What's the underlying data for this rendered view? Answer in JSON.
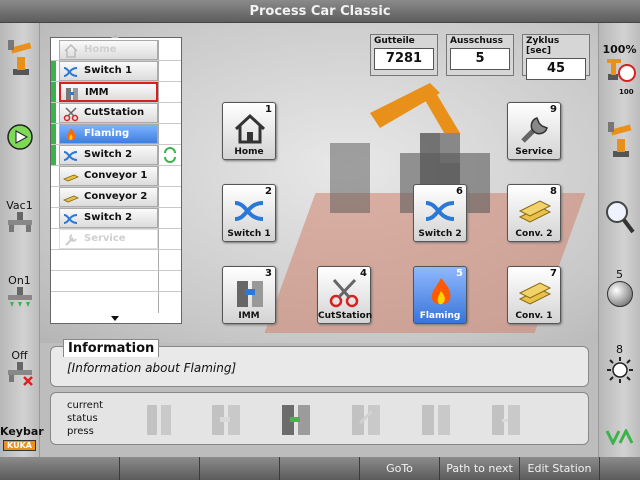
{
  "window": {
    "title": "Process Car Classic"
  },
  "left_panel": {
    "items": [
      {
        "label": ""
      },
      {
        "label": ""
      },
      {
        "label": "Vac1"
      },
      {
        "label": "On1"
      },
      {
        "label": "Off"
      },
      {
        "label": "Keybar",
        "badge": "KUKA"
      }
    ]
  },
  "right_panel": {
    "zoom": "100%",
    "speed_badge": "100",
    "knob_top_label": "5",
    "sun_label": "8"
  },
  "station_list": {
    "rows": [
      {
        "label": "Home",
        "state": "disabled",
        "icon": "home-icon",
        "bar": "#ffffff"
      },
      {
        "label": "Switch 1",
        "state": "normal",
        "icon": "switch-icon",
        "bar": "#3cb34a"
      },
      {
        "label": "IMM",
        "state": "boxed",
        "icon": "imm-icon",
        "bar": "#3cb34a"
      },
      {
        "label": "CutStation",
        "state": "normal",
        "icon": "scissors-icon",
        "bar": "#3cb34a"
      },
      {
        "label": "Flaming",
        "state": "selected",
        "icon": "flame-icon",
        "bar": "#3cb34a"
      },
      {
        "label": "Switch 2",
        "state": "normal",
        "icon": "switch-icon",
        "bar": "#3cb34a",
        "side_icon": "green-arrows-icon"
      },
      {
        "label": "Conveyor 1",
        "state": "normal",
        "icon": "conveyor-icon",
        "bar": "#ffffff"
      },
      {
        "label": "Conveyor 2",
        "state": "normal",
        "icon": "conveyor-icon",
        "bar": "#ffffff"
      },
      {
        "label": "Switch 2",
        "state": "normal",
        "icon": "switch-icon",
        "bar": "#ffffff"
      },
      {
        "label": "Service",
        "state": "disabled",
        "icon": "wrench-icon",
        "bar": "#ffffff"
      },
      {
        "label": "",
        "state": "empty",
        "icon": "",
        "bar": "#ffffff"
      },
      {
        "label": "",
        "state": "empty",
        "icon": "",
        "bar": "#ffffff"
      },
      {
        "label": "",
        "state": "empty",
        "icon": "",
        "bar": "#ffffff"
      }
    ]
  },
  "counters": [
    {
      "label": "Gutteile",
      "value": "7281"
    },
    {
      "label": "Ausschuss",
      "value": "5"
    },
    {
      "label": "Zyklus [sec]",
      "value": "45"
    }
  ],
  "stations": [
    {
      "num": "1",
      "label": "Home",
      "icon": "home-icon"
    },
    {
      "num": "9",
      "label": "Service",
      "icon": "wrench-icon"
    },
    {
      "num": "2",
      "label": "Switch 1",
      "icon": "switch-icon"
    },
    {
      "num": "6",
      "label": "Switch 2",
      "icon": "switch-icon"
    },
    {
      "num": "8",
      "label": "Conv. 2",
      "icon": "conveyor-icon"
    },
    {
      "num": "3",
      "label": "IMM",
      "icon": "imm-icon"
    },
    {
      "num": "4",
      "label": "CutStation",
      "icon": "scissors-icon"
    },
    {
      "num": "5",
      "label": "Flaming",
      "icon": "flame-icon",
      "active": true
    },
    {
      "num": "7",
      "label": "Conv. 1",
      "icon": "conveyor-icon"
    }
  ],
  "info": {
    "title": "Information",
    "text": "[Information about Flaming]"
  },
  "status": {
    "line1": "current",
    "line2": "status",
    "line3": "press"
  },
  "bottom_buttons": [
    {
      "label": ""
    },
    {
      "label": ""
    },
    {
      "label": ""
    },
    {
      "label": ""
    },
    {
      "label": "GoTo"
    },
    {
      "label": "Path to next"
    },
    {
      "label": "Edit Station"
    }
  ],
  "colors": {
    "selected": "#3d7fe0",
    "green_bar": "#3cb34a",
    "robot_orange": "#e8901a",
    "red_box": "#d82020"
  }
}
